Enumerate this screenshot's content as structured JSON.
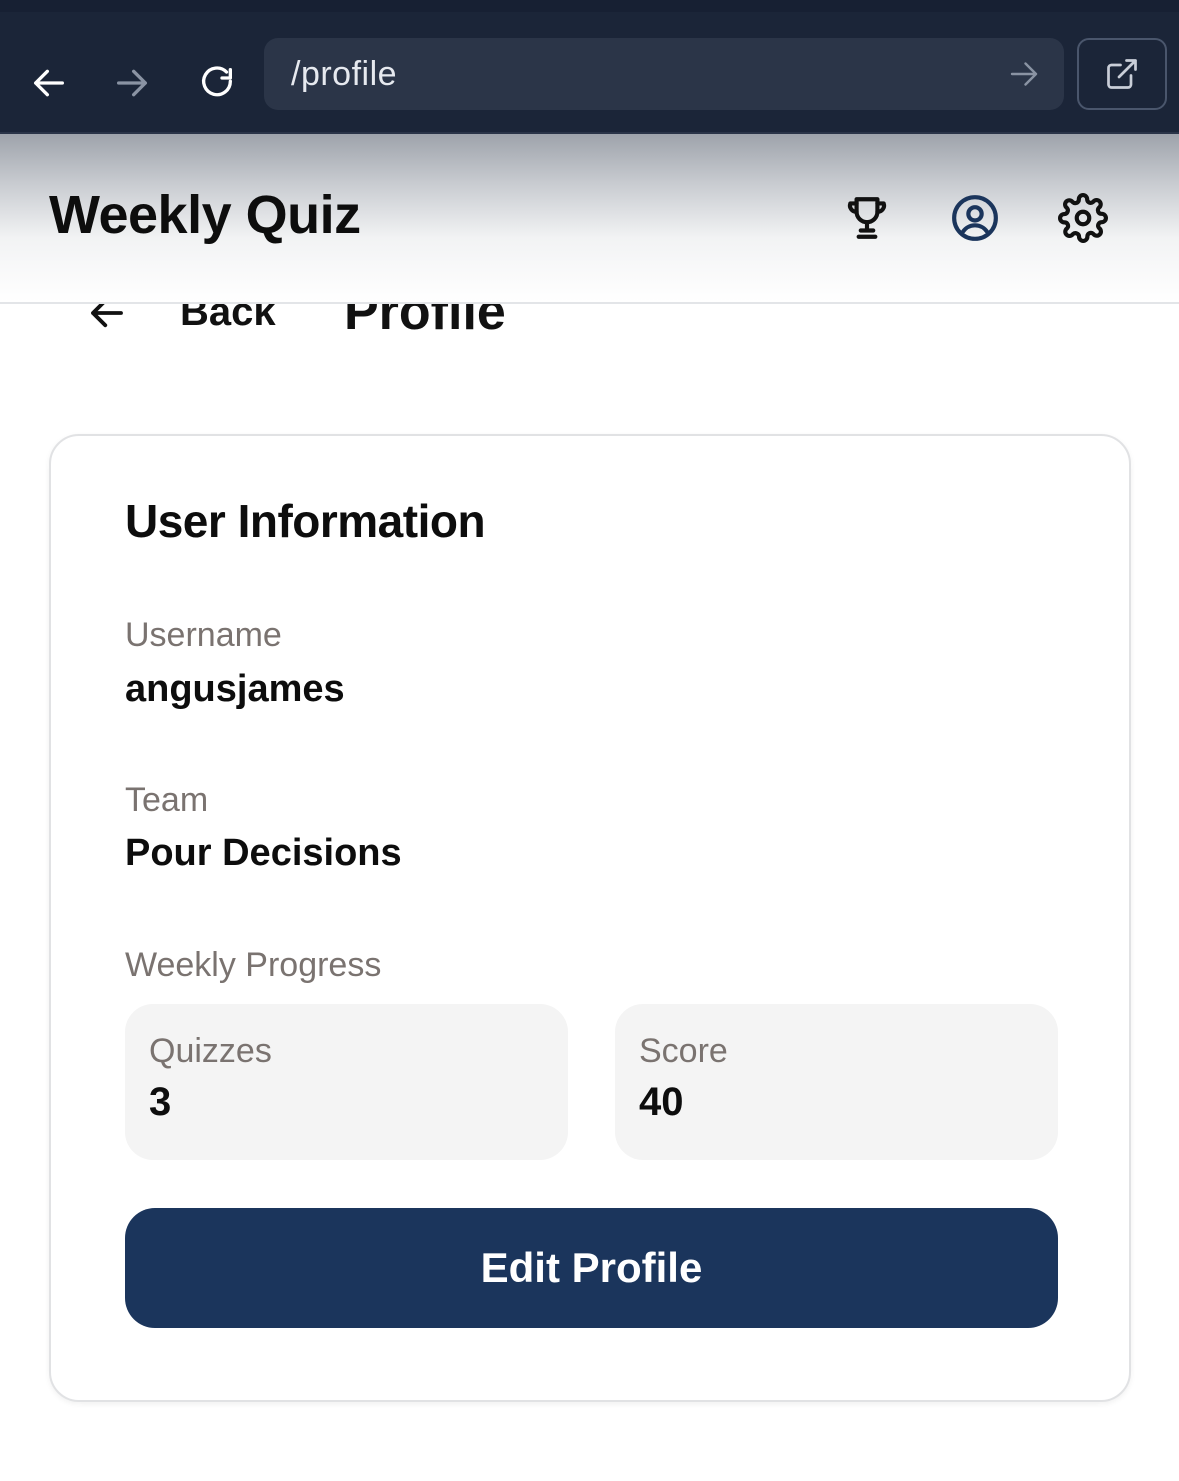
{
  "browser": {
    "url": "/profile",
    "icons": {
      "back": "arrow-left-icon",
      "forward": "arrow-right-icon",
      "reload": "reload-icon",
      "go": "arrow-right-icon",
      "open_external": "external-link-icon"
    }
  },
  "header": {
    "title": "Weekly Quiz",
    "icons": [
      "trophy-icon",
      "user-circle-icon",
      "gear-icon"
    ],
    "active_icon_color": "#1b355c"
  },
  "subheader": {
    "back_label": "Back",
    "page_title": "Profile"
  },
  "card": {
    "title": "User Information",
    "username_label": "Username",
    "username_value": "angusjames",
    "team_label": "Team",
    "team_value": "Pour Decisions",
    "progress_label": "Weekly Progress",
    "stats": [
      {
        "label": "Quizzes",
        "value": "3"
      },
      {
        "label": "Score",
        "value": "40"
      }
    ],
    "edit_button_label": "Edit Profile",
    "button_color": "#1b355c"
  }
}
